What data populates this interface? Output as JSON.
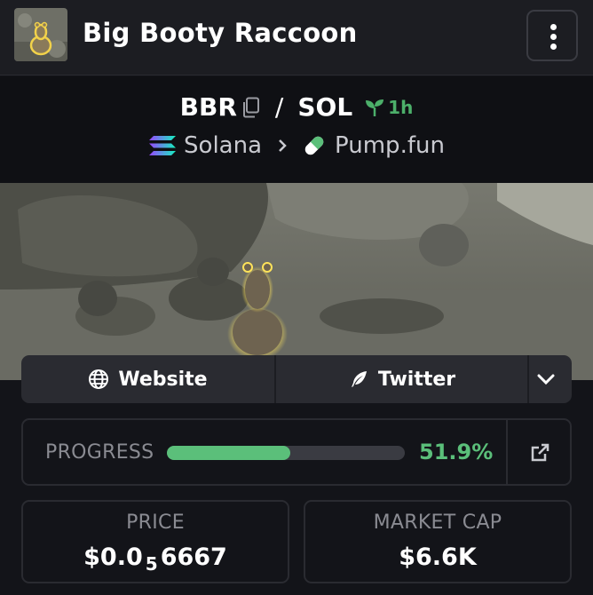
{
  "header": {
    "token_name": "Big Booty Raccoon",
    "avatar_icon": "raccoon-avatar-icon",
    "menu_icon": "kebab-menu-icon"
  },
  "pair": {
    "base_symbol": "BBR",
    "separator": "/",
    "quote_symbol": "SOL",
    "age": "1h",
    "chain": "Solana",
    "dex": "Pump.fun"
  },
  "links": {
    "website": "Website",
    "twitter": "Twitter"
  },
  "progress": {
    "label": "PROGRESS",
    "value_text": "51.9%",
    "fraction": 0.519
  },
  "stats": {
    "price_label": "PRICE",
    "price_prefix": "$0.0",
    "price_zero_count": "5",
    "price_digits": "6667",
    "market_cap_label": "MARKET CAP",
    "market_cap_value": "$6.6K"
  },
  "colors": {
    "accent_green": "#5bbf7a",
    "background": "#131419",
    "card_border": "#2a2b31"
  }
}
